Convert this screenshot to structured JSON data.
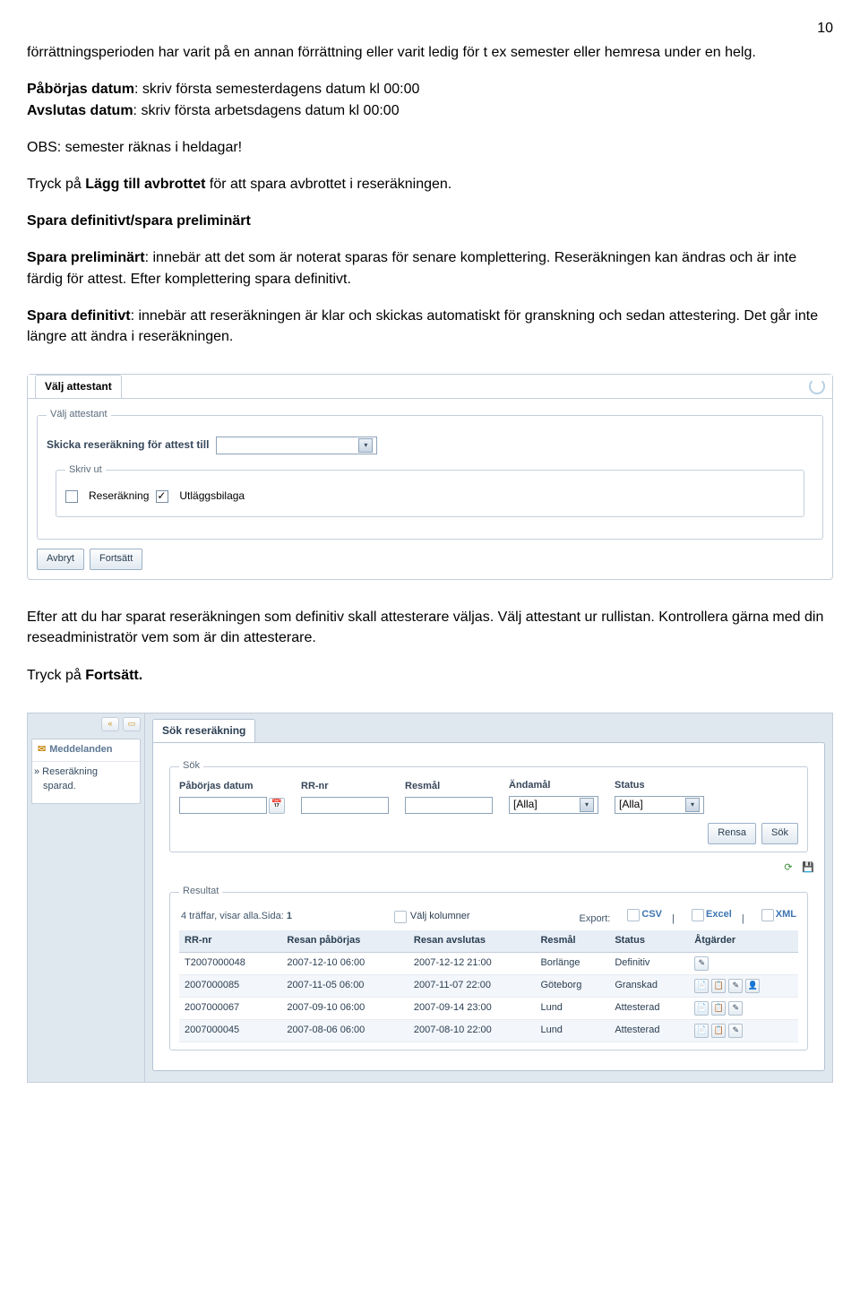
{
  "page_number": "10",
  "intro": "förrättningsperioden har varit på en annan förrättning eller varit ledig för t ex semester eller hemresa under en helg.",
  "p1a": "Påbörjas datum",
  "p1b": ": skriv första semesterdagens datum kl 00:00",
  "p2a": "Avslutas datum",
  "p2b": ": skriv första arbetsdagens datum kl 00:00",
  "obs": "OBS: semester räknas i heldagar!",
  "p3a": "Tryck på ",
  "p3b": "Lägg till avbrottet",
  "p3c": " för att spara avbrottet i reseräkningen.",
  "h1": "Spara definitivt/spara preliminärt",
  "sp1a": "Spara preliminärt",
  "sp1b": ": innebär att det som är noterat sparas för senare komplettering. Reseräkningen kan ändras och är inte färdig för attest. Efter komplettering spara definitivt.",
  "sp2a": "Spara definitivt",
  "sp2b": ": innebär att reseräkningen är klar och skickas automatiskt för granskning och sedan attestering. Det går inte längre att ändra i reseräkningen.",
  "attest": {
    "tab": "Välj attestant",
    "legend1": "Välj attestant",
    "label1": "Skicka reseräkning för attest till",
    "legend2": "Skriv ut",
    "cb1": "Reseräkning",
    "cb2": "Utläggsbilaga",
    "btn_cancel": "Avbryt",
    "btn_continue": "Fortsätt"
  },
  "after_text": "Efter att du har sparat reseräkningen som definitiv skall attesterare väljas. Välj attestant ur rullistan. Kontrollera gärna med din reseadministratör vem som är din attesterare.",
  "press_a": "Tryck på ",
  "press_b": "Fortsätt.",
  "search": {
    "sb_title": "Meddelanden",
    "sb_msg_a": "» Reseräkning",
    "sb_msg_b": "sparad.",
    "tab": "Sök reseräkning",
    "legend_sok": "Sök",
    "legend_res": "Resultat",
    "headers": {
      "c1": "Påbörjas datum",
      "c2": "RR-nr",
      "c3": "Resmål",
      "c4": "Ändamål",
      "c5": "Status"
    },
    "allla": "[Alla]",
    "btn_rensa": "Rensa",
    "btn_sok": "Sök",
    "hits_a": "4 träffar, visar alla.Sida: ",
    "hits_b": "1",
    "valj_kol": "Välj kolumner",
    "export": "Export:",
    "ex1": "CSV",
    "ex2": "Excel",
    "ex3": "XML",
    "th": {
      "c1": "RR-nr",
      "c2": "Resan påbörjas",
      "c3": "Resan avslutas",
      "c4": "Resmål",
      "c5": "Status",
      "c6": "Åtgärder"
    },
    "rows": [
      {
        "rr": "T2007000048",
        "start": "2007-12-10 06:00",
        "end": "2007-12-12 21:00",
        "dest": "Borlänge",
        "status": "Definitiv",
        "actions": [
          "edit"
        ]
      },
      {
        "rr": "2007000085",
        "start": "2007-11-05 06:00",
        "end": "2007-11-07 22:00",
        "dest": "Göteborg",
        "status": "Granskad",
        "actions": [
          "export",
          "copy",
          "edit",
          "user"
        ]
      },
      {
        "rr": "2007000067",
        "start": "2007-09-10 06:00",
        "end": "2007-09-14 23:00",
        "dest": "Lund",
        "status": "Attesterad",
        "actions": [
          "export",
          "copy",
          "edit"
        ]
      },
      {
        "rr": "2007000045",
        "start": "2007-08-06 06:00",
        "end": "2007-08-10 22:00",
        "dest": "Lund",
        "status": "Attesterad",
        "actions": [
          "export",
          "copy",
          "edit"
        ]
      }
    ]
  }
}
